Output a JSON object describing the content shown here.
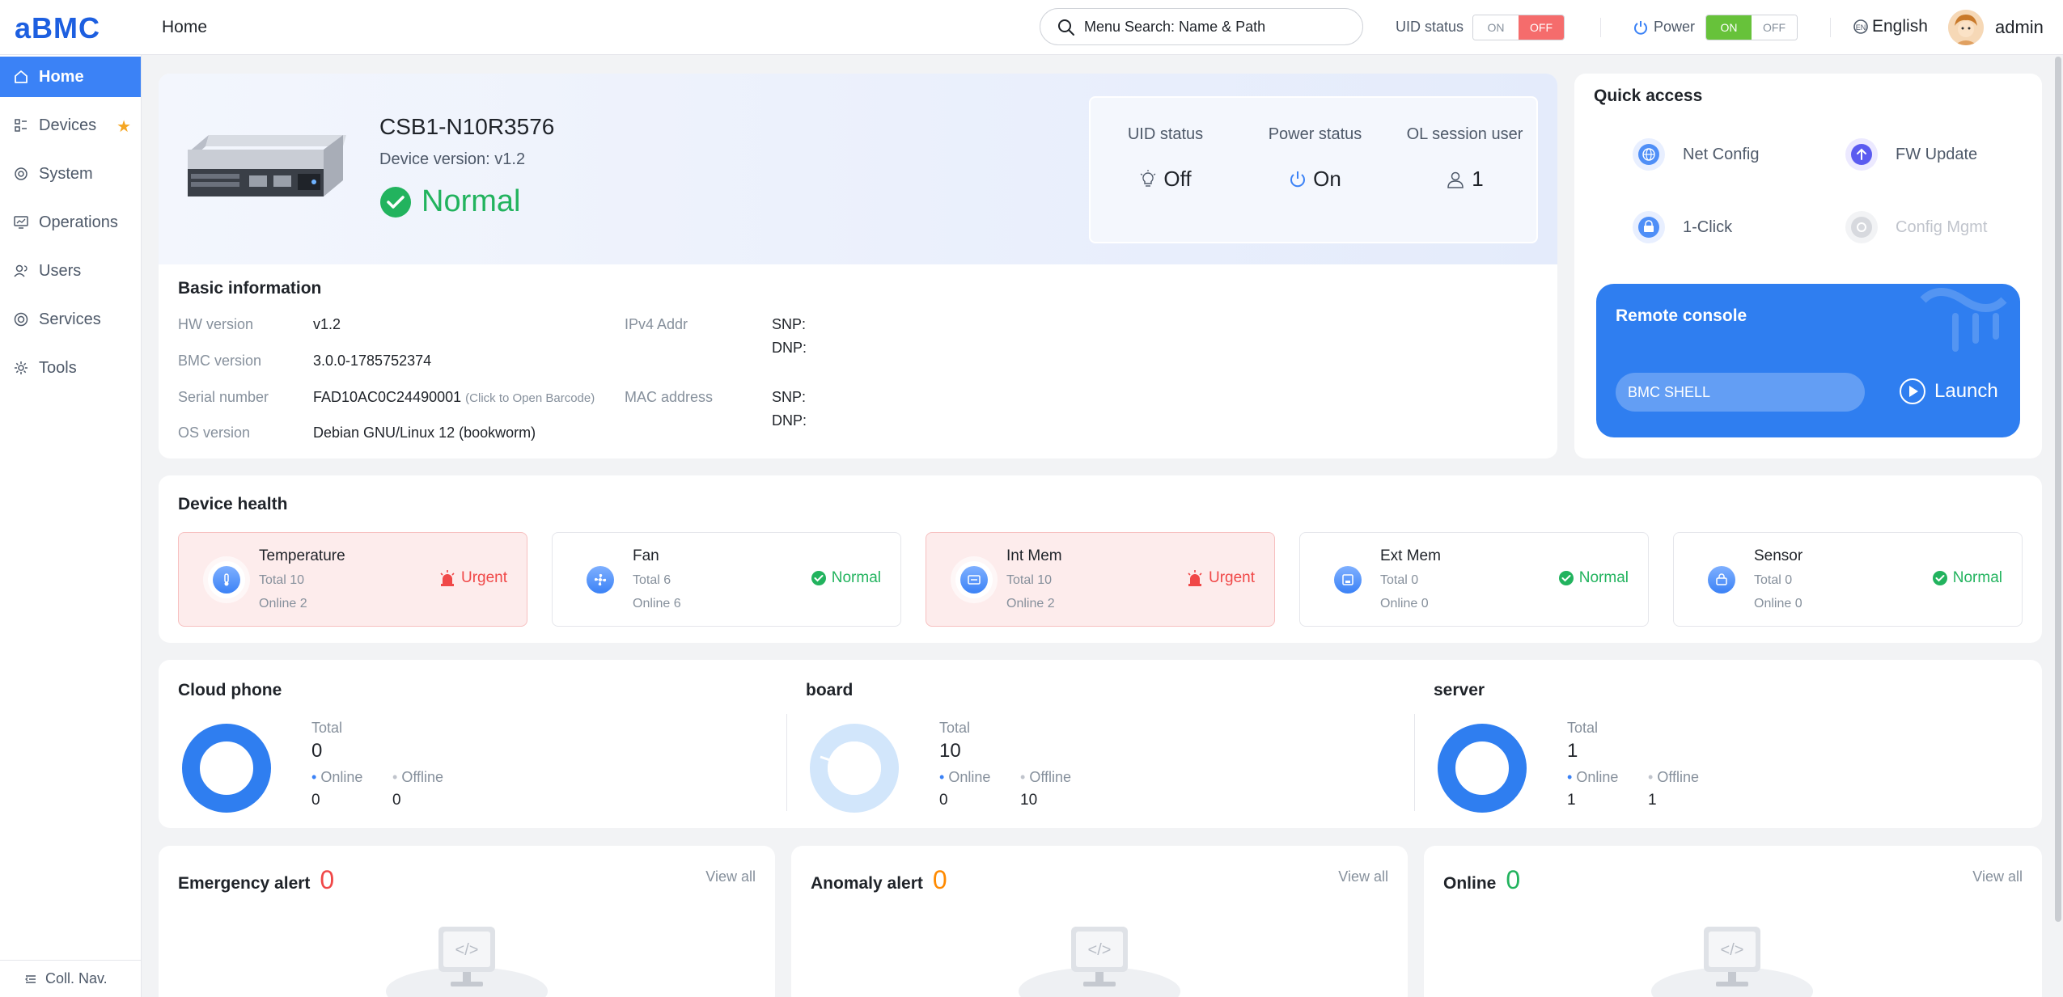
{
  "app": {
    "logo": "aBMC",
    "page_title": "Home"
  },
  "topbar": {
    "search_placeholder": "Menu Search: Name & Path",
    "uid_label": "UID status",
    "uid_on": "ON",
    "uid_off": "OFF",
    "power_label": "Power",
    "power_on": "ON",
    "power_off": "OFF",
    "language": "English",
    "user": "admin",
    "colors": {
      "off_active": "#f56c6c",
      "on_active": "#67c23a"
    }
  },
  "sidebar": {
    "items": [
      {
        "label": "Home",
        "icon": "home-icon",
        "active": true
      },
      {
        "label": "Devices",
        "icon": "devices-icon",
        "starred": true
      },
      {
        "label": "System",
        "icon": "system-icon"
      },
      {
        "label": "Operations",
        "icon": "operations-icon"
      },
      {
        "label": "Users",
        "icon": "users-icon"
      },
      {
        "label": "Services",
        "icon": "services-icon"
      },
      {
        "label": "Tools",
        "icon": "tools-icon"
      }
    ],
    "collapse_label": "Coll. Nav.",
    "accent": "#3b82f6"
  },
  "device": {
    "name": "CSB1-N10R3576",
    "version": "Device version: v1.2",
    "status": "Normal",
    "status_color": "#22b35e",
    "uid_status_label": "UID status",
    "uid_status_value": "Off",
    "power_status_label": "Power status",
    "power_status_value": "On",
    "session_label": "OL session user",
    "session_value": "1"
  },
  "basic_info": {
    "title": "Basic information",
    "hw_label": "HW version",
    "hw_value": "v1.2",
    "bmc_label": "BMC version",
    "bmc_value": "3.0.0-1785752374",
    "serial_label": "Serial number",
    "serial_value": "FAD10AC0C24490001",
    "serial_hint": "(Click to Open Barcode)",
    "os_label": "OS version",
    "os_value": "Debian GNU/Linux 12 (bookworm)",
    "ipv4_label": "IPv4 Addr",
    "ipv4_snp": "SNP:",
    "ipv4_dnp": "DNP:",
    "mac_label": "MAC address",
    "mac_snp": "SNP:",
    "mac_dnp": "DNP:"
  },
  "quick_access": {
    "title": "Quick access",
    "items": [
      {
        "label": "Net Config",
        "icon": "globe-icon",
        "enabled": true
      },
      {
        "label": "FW Update",
        "icon": "upload-icon",
        "enabled": true
      },
      {
        "label": "1-Click",
        "icon": "one-click-icon",
        "enabled": true
      },
      {
        "label": "Config Mgmt",
        "icon": "config-icon",
        "enabled": false
      }
    ],
    "remote_title": "Remote console",
    "shell_value": "BMC SHELL",
    "launch_label": "Launch"
  },
  "device_health": {
    "title": "Device health",
    "items": [
      {
        "name": "Temperature",
        "total_label": "Total",
        "total": "10",
        "online_label": "Online",
        "online": "2",
        "status": "Urgent",
        "icon": "thermometer-icon"
      },
      {
        "name": "Fan",
        "total_label": "Total",
        "total": "6",
        "online_label": "Online",
        "online": "6",
        "status": "Normal",
        "icon": "fan-icon"
      },
      {
        "name": "Int Mem",
        "total_label": "Total",
        "total": "10",
        "online_label": "Online",
        "online": "2",
        "status": "Urgent",
        "icon": "memory-icon"
      },
      {
        "name": "Ext Mem",
        "total_label": "Total",
        "total": "0",
        "online_label": "Online",
        "online": "0",
        "status": "Normal",
        "icon": "storage-icon"
      },
      {
        "name": "Sensor",
        "total_label": "Total",
        "total": "0",
        "online_label": "Online",
        "online": "0",
        "status": "Normal",
        "icon": "sensor-icon"
      }
    ]
  },
  "stats": [
    {
      "title": "Cloud phone",
      "total_label": "Total",
      "total": "0",
      "online_label": "Online",
      "online": "0",
      "offline_label": "Offline",
      "offline": "0",
      "online_fraction": 1.0
    },
    {
      "title": "board",
      "total_label": "Total",
      "total": "10",
      "online_label": "Online",
      "online": "0",
      "offline_label": "Offline",
      "offline": "10",
      "online_fraction": 0.0
    },
    {
      "title": "server",
      "total_label": "Total",
      "total": "1",
      "online_label": "Online",
      "online": "1",
      "offline_label": "Offline",
      "offline": "1",
      "online_fraction": 1.0
    }
  ],
  "alerts": [
    {
      "title": "Emergency alert",
      "count": "0",
      "color": "#f04848",
      "view_all": "View all"
    },
    {
      "title": "Anomaly alert",
      "count": "0",
      "color": "#ff8a00",
      "view_all": "View all"
    },
    {
      "title": "Online",
      "count": "0",
      "color": "#22b35e",
      "view_all": "View all"
    }
  ]
}
